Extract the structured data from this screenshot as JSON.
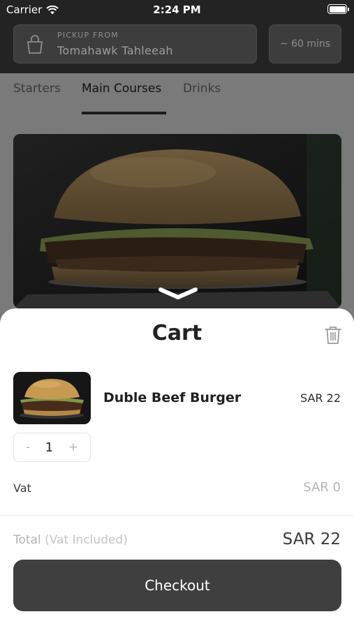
{
  "status_bar": {
    "carrier": "Carrier",
    "time": "2:24 PM"
  },
  "pickup": {
    "label": "PICKUP FROM",
    "name": "Tomahawk Tahleeah"
  },
  "eta": "~ 60 mins",
  "tabs": [
    {
      "label": "Starters"
    },
    {
      "label": "Main Courses",
      "selected": true
    },
    {
      "label": "Drinks"
    }
  ],
  "cart": {
    "title": "Cart",
    "item": {
      "name": "Duble Beef Burger",
      "price": "SAR 22",
      "quantity": "1",
      "minus": "-",
      "plus": "+"
    },
    "vat": {
      "label": "Vat",
      "value": "SAR 0"
    },
    "total": {
      "label": "Total",
      "sublabel": "(Vat Included)",
      "value": "SAR 22"
    },
    "checkout_label": "Checkout"
  },
  "icons": {
    "wifi": "wifi-icon",
    "battery": "battery-icon",
    "bag": "shopping-bag-icon",
    "trash": "trash-icon",
    "chevron": "chevron-down-icon"
  },
  "colors": {
    "header_bg": "#232323",
    "overlay": "#7a7a7a",
    "button": "#3f3f3f"
  }
}
